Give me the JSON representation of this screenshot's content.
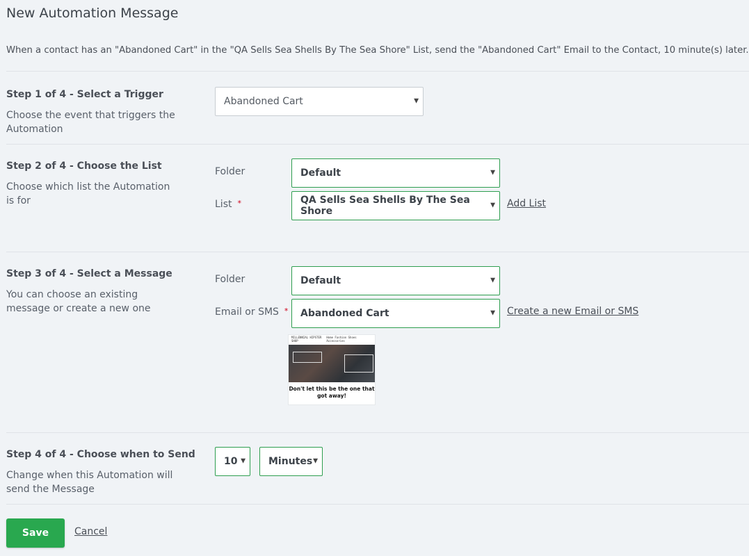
{
  "page": {
    "title": "New Automation Message",
    "summary": "When a contact has an \"Abandoned Cart\" in the \"QA Sells Sea Shells By The Sea Shore\" List, send the \"Abandoned Cart\" Email to the Contact, 10 minute(s) later."
  },
  "steps": {
    "step1": {
      "title": "Step 1 of 4 - Select a Trigger",
      "desc": "Choose the event that triggers the Automation",
      "trigger_value": "Abandoned Cart"
    },
    "step2": {
      "title": "Step 2 of 4 - Choose the List",
      "desc": "Choose which list the Automation is for",
      "folder_label": "Folder",
      "folder_value": "Default",
      "list_label": "List",
      "list_value": "QA Sells Sea Shells By The Sea Shore",
      "add_list": "Add List"
    },
    "step3": {
      "title": "Step 3 of 4 - Select a Message",
      "desc": "You can choose an existing message or create a new one",
      "folder_label": "Folder",
      "folder_value": "Default",
      "message_label": "Email or SMS",
      "message_value": "Abandoned Cart",
      "create_link": "Create a new Email or SMS",
      "preview": {
        "shop_name": "MILLENNIAL HIPSTER SHOP",
        "nav": "Home  Fashion  Shoes  Accessories",
        "headline": "Don't let this be the one that got away!"
      }
    },
    "step4": {
      "title": "Step 4 of 4 - Choose when to Send",
      "desc": "Change when this Automation will send the Message",
      "amount_value": "10",
      "unit_value": "Minutes"
    }
  },
  "actions": {
    "save": "Save",
    "cancel": "Cancel"
  },
  "required_marker": "*",
  "caret": "▼",
  "colors": {
    "accent": "#29a84f",
    "valid_border": "#2e9e4f",
    "required": "#d0021b",
    "background": "#f0f3f6"
  }
}
